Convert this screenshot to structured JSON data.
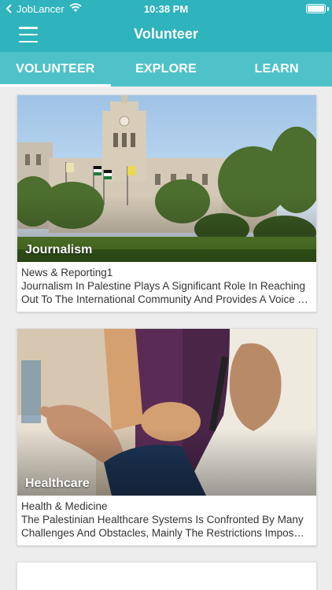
{
  "status_bar": {
    "carrier": "JobLancer",
    "time": "10:38 PM"
  },
  "header": {
    "title": "Volunteer"
  },
  "tabs": [
    {
      "label": "VOLUNTEER",
      "active": true
    },
    {
      "label": "EXPLORE",
      "active": false
    },
    {
      "label": "LEARN",
      "active": false
    }
  ],
  "cards": [
    {
      "image_label": "Journalism",
      "category": "News & Reporting1",
      "description": "Journalism In Palestine Plays A Significant Role In Reaching Out To The International Community And Provides A Voice To The Palestinian Cause"
    },
    {
      "image_label": "Healthcare",
      "category": "Health & Medicine",
      "description": "The Palestinian Healthcare Systems Is Confronted By Many Challenges And Obstacles, Mainly The Restrictions Imposed On Movement"
    }
  ],
  "colors": {
    "header_bg": "#2fb3bc",
    "tabs_bg": "#4fc2c9",
    "page_bg": "#ededed"
  }
}
